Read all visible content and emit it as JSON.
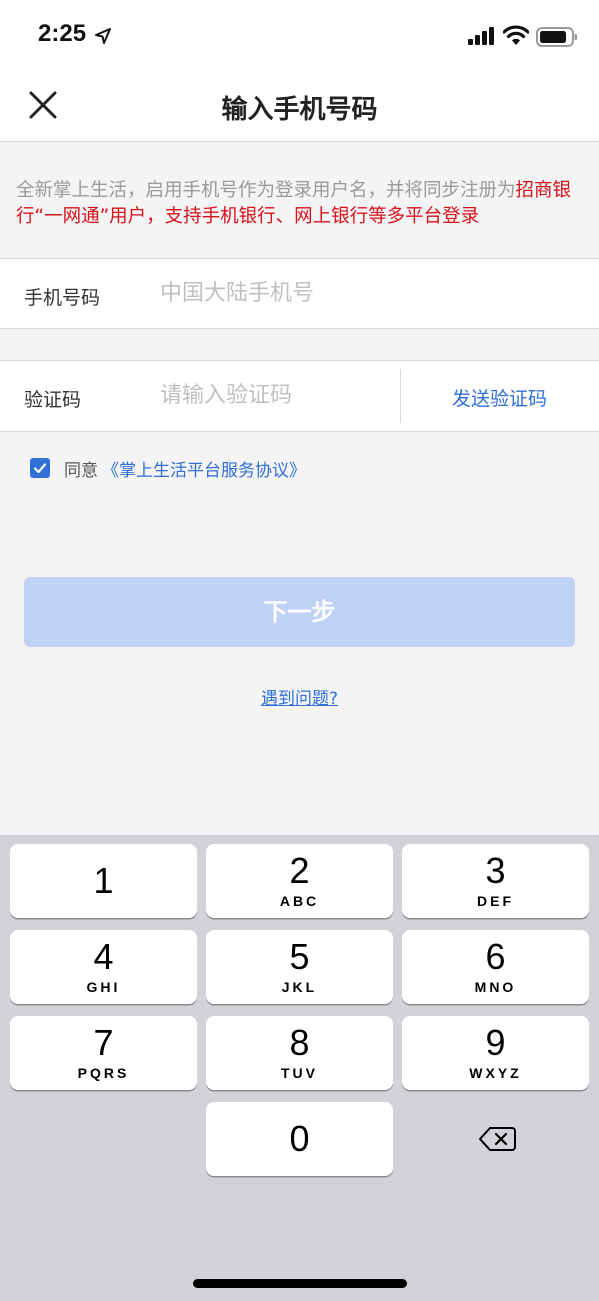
{
  "status_bar": {
    "time": "2:25",
    "icons": [
      "location-arrow-icon",
      "cellular-signal-icon",
      "wifi-icon",
      "battery-icon"
    ]
  },
  "nav": {
    "title": "输入手机号码",
    "close_icon": "close-icon"
  },
  "notice": {
    "text_gray": "全新掌上生活，启用手机号作为登录用户名，并将同步注册为",
    "text_red": "招商银行“一网通”用户，支持手机银行、网上银行等多平台登录",
    "highlight_color": "#d8101a"
  },
  "phone_field": {
    "label": "手机号码",
    "placeholder": "中国大陆手机号",
    "value": ""
  },
  "code_field": {
    "label": "验证码",
    "placeholder": "请输入验证码",
    "value": "",
    "send_button": "发送验证码"
  },
  "agreement": {
    "checked": true,
    "prefix": "同意",
    "link": "《掌上生活平台服务协议》"
  },
  "next_button": "下一步",
  "help_link": "遇到问题?",
  "colors": {
    "accent": "#2f6fd6",
    "button_disabled": "#bfd2f5",
    "keyboard_bg": "#d1d3d9"
  },
  "keypad": {
    "keys": [
      {
        "num": "1",
        "letters": ""
      },
      {
        "num": "2",
        "letters": "ABC"
      },
      {
        "num": "3",
        "letters": "DEF"
      },
      {
        "num": "4",
        "letters": "GHI"
      },
      {
        "num": "5",
        "letters": "JKL"
      },
      {
        "num": "6",
        "letters": "MNO"
      },
      {
        "num": "7",
        "letters": "PQRS"
      },
      {
        "num": "8",
        "letters": "TUV"
      },
      {
        "num": "9",
        "letters": "WXYZ"
      },
      {
        "num": "0",
        "letters": ""
      }
    ],
    "delete_icon": "backspace-icon"
  }
}
